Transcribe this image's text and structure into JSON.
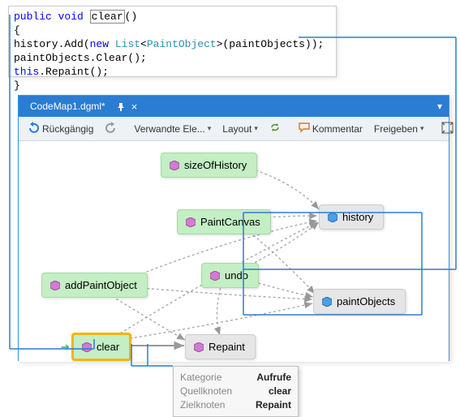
{
  "code": {
    "keyword_public": "public",
    "keyword_void": "void",
    "method_name": "clear",
    "parens": "()",
    "brace_open": "{",
    "line1_a": "   history.Add(",
    "keyword_new": "new",
    "type_list": "List",
    "type_paint": "PaintObject",
    "line1_b": ">(paintObjects));",
    "line2": "   paintObjects.Clear();",
    "keyword_this": "this",
    "line3_b": ".Repaint();",
    "brace_close": "}"
  },
  "window": {
    "title": "CodeMap1.dgml*",
    "close": "×",
    "chev": "▾"
  },
  "toolbar": {
    "undo_label": "Rückgängig",
    "related": "Verwandte Ele...",
    "layout": "Layout",
    "comment": "Kommentar",
    "share": "Freigeben"
  },
  "nodes": {
    "sizeOfHistory": "sizeOfHistory",
    "history": "history",
    "paintCanvas": "PaintCanvas",
    "addPaintObject": "addPaintObject",
    "undo": "undo",
    "paintObjects": "paintObjects",
    "clear": "clear",
    "repaint": "Repaint"
  },
  "tooltip": {
    "cat_label": "Kategorie",
    "cat_value": "Aufrufe",
    "src_label": "Quellknoten",
    "src_value": "clear",
    "dst_label": "Zielknoten",
    "dst_value": "Repaint"
  }
}
